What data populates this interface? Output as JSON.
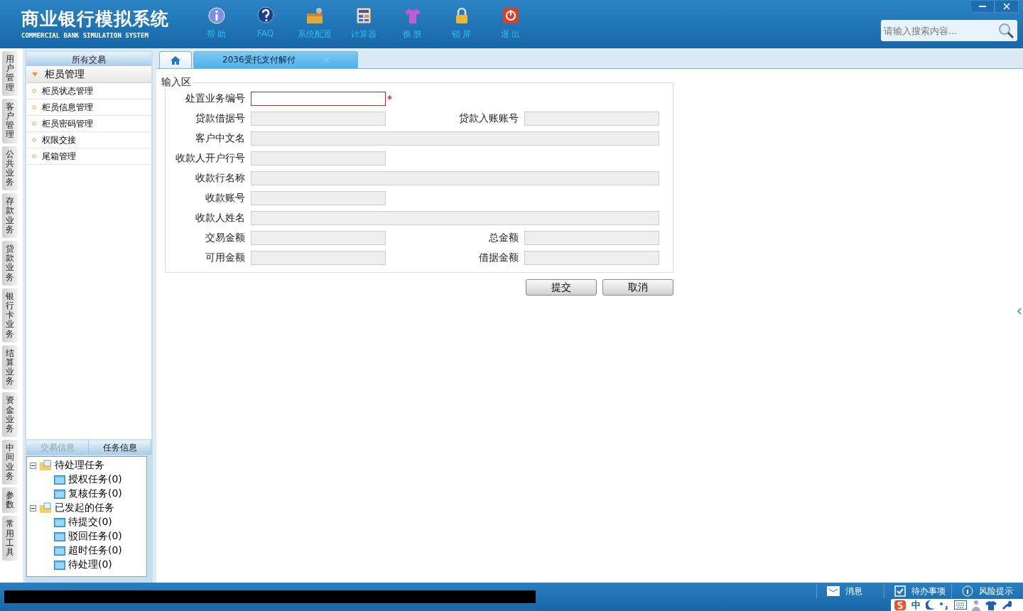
{
  "header": {
    "title": "商业银行模拟系统",
    "subtitle": "COMMERCIAL BANK SIMULATION SYSTEM",
    "tools": [
      {
        "kind": "info",
        "label": "帮 助"
      },
      {
        "kind": "faq",
        "label": "FAQ"
      },
      {
        "kind": "config",
        "label": "系统配置"
      },
      {
        "kind": "calculator",
        "label": "计算器"
      },
      {
        "kind": "skin",
        "label": "换 肤"
      },
      {
        "kind": "lock",
        "label": "锁 屏"
      },
      {
        "kind": "exit",
        "label": "退 出"
      }
    ],
    "search": {
      "placeholder": "请输入搜索内容..."
    }
  },
  "side_tabs": [
    "用户管理",
    "客户管理",
    "公共业务",
    "存款业务",
    "贷款业务",
    "银行卡业务",
    "结算业务",
    "资金业务",
    "中间业务",
    "参数",
    "常用工具"
  ],
  "sidebar": {
    "title": "所有交易",
    "group": {
      "label": "柜员管理",
      "expanded": true,
      "items": [
        "柜员状态管理",
        "柜员信息管理",
        "柜员密码管理",
        "权限交接",
        "尾箱管理"
      ]
    }
  },
  "task_panel": {
    "tabs": [
      {
        "label": "交易信息",
        "selected": false
      },
      {
        "label": "任务信息",
        "selected": true
      }
    ],
    "tree": [
      {
        "label": "待处理任务",
        "expanded": true,
        "children": [
          {
            "label": "授权任务(0)"
          },
          {
            "label": "复核任务(0)"
          }
        ]
      },
      {
        "label": "已发起的任务",
        "expanded": true,
        "children": [
          {
            "label": "待提交(0)"
          },
          {
            "label": "驳回任务(0)"
          },
          {
            "label": "超时任务(0)"
          },
          {
            "label": "待处理(0)"
          }
        ]
      }
    ]
  },
  "tabs": [
    {
      "kind": "home",
      "selected": false
    },
    {
      "kind": "page",
      "label": "2036受托支付解付",
      "selected": true
    }
  ],
  "form": {
    "legend": "输入区",
    "rows": [
      [
        {
          "label": "处置业务编号",
          "kind": "short",
          "required": true,
          "disabled": false
        }
      ],
      [
        {
          "label": "贷款借据号",
          "kind": "short",
          "required": false,
          "disabled": true
        },
        {
          "label": "贷款入账账号",
          "kind": "short",
          "required": false,
          "disabled": true
        }
      ],
      [
        {
          "label": "客户中文名",
          "kind": "long",
          "required": false,
          "disabled": true
        }
      ],
      [
        {
          "label": "收款人开户行号",
          "kind": "short",
          "required": false,
          "disabled": true
        }
      ],
      [
        {
          "label": "收款行名称",
          "kind": "long",
          "required": false,
          "disabled": true
        }
      ],
      [
        {
          "label": "收款账号",
          "kind": "short",
          "required": false,
          "disabled": true
        }
      ],
      [
        {
          "label": "收款人姓名",
          "kind": "long",
          "required": false,
          "disabled": true
        }
      ],
      [
        {
          "label": "交易金额",
          "kind": "short",
          "required": false,
          "disabled": true
        },
        {
          "label": "总金额",
          "kind": "short",
          "required": false,
          "disabled": true
        }
      ],
      [
        {
          "label": "可用金额",
          "kind": "short",
          "required": false,
          "disabled": true
        },
        {
          "label": "借据金额",
          "kind": "short",
          "required": false,
          "disabled": true
        }
      ]
    ],
    "required_mark": "*",
    "buttons": [
      "提交",
      "取消"
    ]
  },
  "status_bar": {
    "items": [
      {
        "kind": "message",
        "label": "消息"
      },
      {
        "kind": "todo",
        "label": "待办事项"
      },
      {
        "kind": "risk",
        "label": "风险提示"
      }
    ]
  },
  "ime_bar": {
    "mode": "中"
  }
}
